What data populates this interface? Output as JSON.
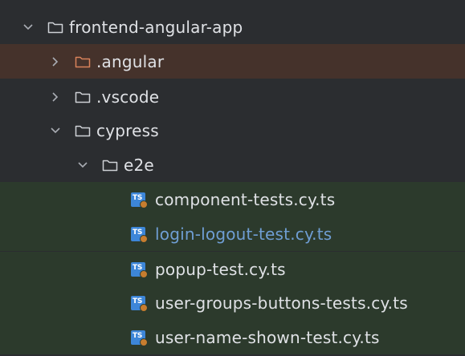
{
  "tree": {
    "root": {
      "label": "frontend-angular-app",
      "expanded": true
    },
    "items": [
      {
        "label": ".angular",
        "type": "folder",
        "state": "collapsed",
        "highlight": "excluded"
      },
      {
        "label": ".vscode",
        "type": "folder",
        "state": "collapsed"
      },
      {
        "label": "cypress",
        "type": "folder",
        "state": "expanded"
      },
      {
        "label": "e2e",
        "type": "folder",
        "state": "expanded"
      }
    ],
    "files": [
      {
        "label": "component-tests.cy.ts",
        "icon": "typescript-test-file-icon"
      },
      {
        "label": "login-logout-test.cy.ts",
        "icon": "typescript-test-file-icon",
        "status": "modified"
      },
      {
        "label": "popup-test.cy.ts",
        "icon": "typescript-test-file-icon"
      },
      {
        "label": "user-groups-buttons-tests.cy.ts",
        "icon": "typescript-test-file-icon"
      },
      {
        "label": "user-name-shown-test.cy.ts",
        "icon": "typescript-test-file-icon"
      }
    ],
    "icon_text": "TS"
  },
  "colors": {
    "background": "#2b2d30",
    "excluded_row": "#45322b",
    "test_row": "#2c3a2c",
    "text": "#dfe1e5",
    "modified_text": "#6f9ed4",
    "excluded_folder": "#d9825b",
    "ts_icon": "#3d86d8"
  }
}
